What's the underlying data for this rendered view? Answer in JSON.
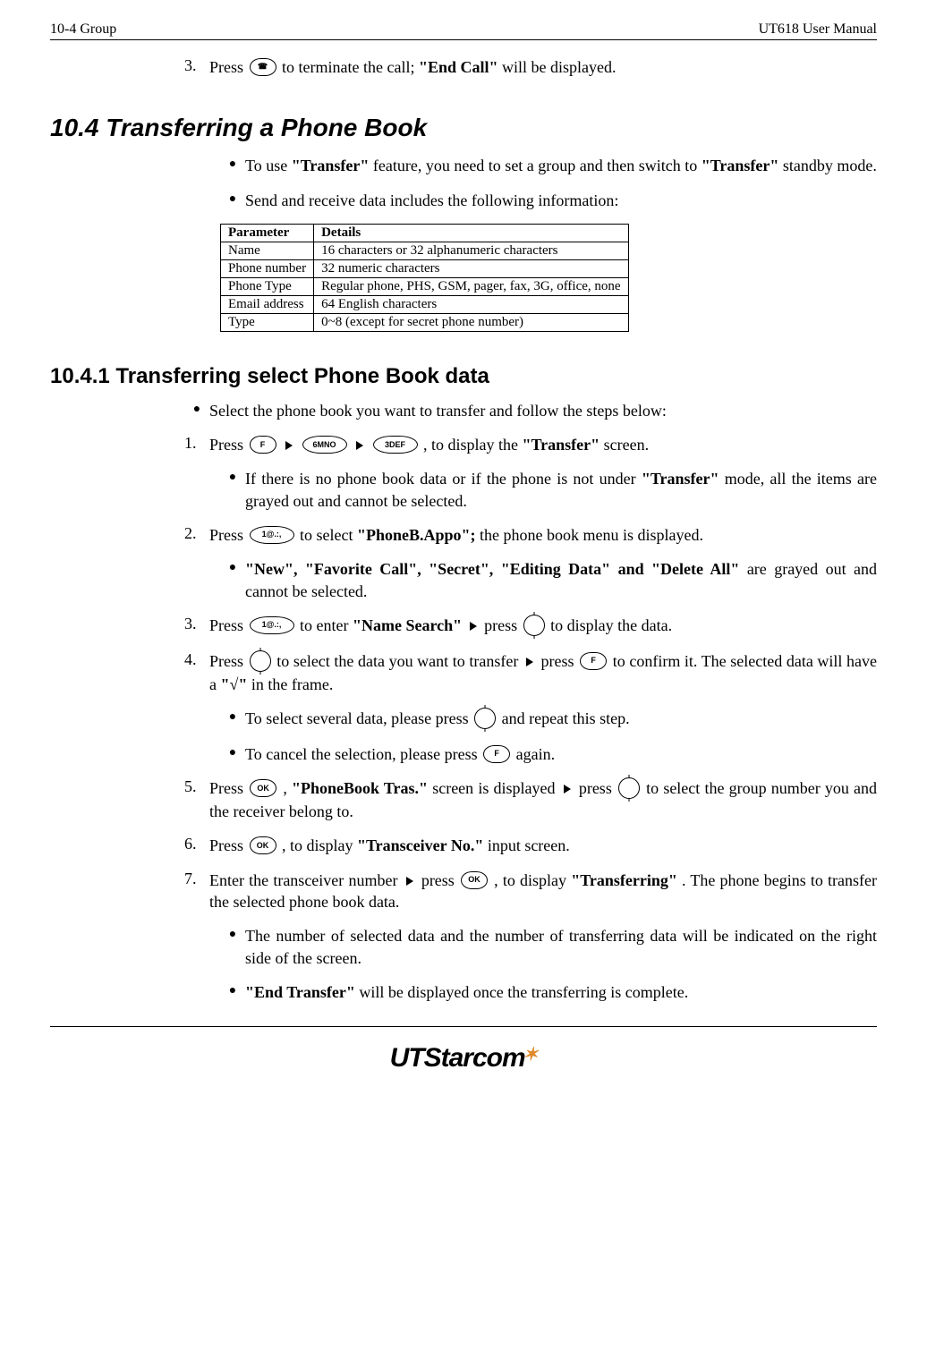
{
  "header": {
    "left": "10-4   Group",
    "right": "UT618 User Manual"
  },
  "step3_top": {
    "num": "3.",
    "pre": "Press ",
    "post": " to terminate the call; ",
    "bold": "\"End Call\"",
    "tail": " will be displayed."
  },
  "ovals": {
    "phone": "☎",
    "F": "F",
    "k6": "6MNO",
    "k3": "3DEF",
    "k1": "1@.:,",
    "OK": "OK"
  },
  "h2": "10.4 Transferring a Phone Book",
  "bul_transfer_use": {
    "text1": "To use ",
    "b1": "\"Transfer\"",
    "text2": " feature, you need to set a group and then switch to ",
    "b2": "\"Transfer\"",
    "text3": " standby mode."
  },
  "bul_send_receive": "Send and receive data includes the following information:",
  "table": {
    "headers": [
      "Parameter",
      "Details"
    ],
    "rows": [
      [
        "Name",
        "16 characters or 32 alphanumeric characters"
      ],
      [
        "Phone number",
        "32 numeric characters"
      ],
      [
        "Phone Type",
        "Regular phone, PHS, GSM, pager, fax, 3G, office, none"
      ],
      [
        "Email address",
        "64 English characters"
      ],
      [
        "Type",
        "0~8 (except for secret phone number)"
      ]
    ]
  },
  "h3": "10.4.1    Transferring select Phone Book data",
  "bul_select_pb": "Select the phone book you want to transfer and follow the steps below:",
  "step1": {
    "num": "1.",
    "pre": "Press ",
    "post": " , to display the ",
    "bold": "\"Transfer\"",
    "tail": " screen."
  },
  "sub1": {
    "text1": "If there is no phone book data or if the phone is not under ",
    "b1": "\"Transfer\"",
    "text2": " mode, all the items are grayed out and cannot be selected."
  },
  "step2": {
    "num": "2.",
    "pre": "Press ",
    "mid": " to select ",
    "bold": "\"PhoneB.Appo\";",
    "tail": " the phone book menu is displayed."
  },
  "sub2": {
    "b1": "\"New\", \"Favorite Call\", \"Secret\", \"Editing Data\" and \"Delete All\"",
    "text": " are grayed out and cannot be selected."
  },
  "step3b": {
    "num": "3.",
    "pre": "Press ",
    "mid1": " to enter ",
    "b1": "\"Name Search\"",
    "mid2": " press ",
    "tail": " to display the data."
  },
  "step4": {
    "num": "4.",
    "pre": "Press ",
    "mid1": " to select the data you want to transfer ",
    "mid2": " press ",
    "mid3": " to confirm it. The selected data will have a ",
    "b1": "\"√\"",
    "tail": " in the frame."
  },
  "sub4a": {
    "text1": "To select several data, please press ",
    "text2": " and repeat this step."
  },
  "sub4b": {
    "text1": "To cancel the selection, please press ",
    "text2": " again."
  },
  "step5": {
    "num": "5.",
    "pre": "Press ",
    "mid1": ", ",
    "b1": "\"PhoneBook Tras.\"",
    "mid2": " screen is displayed ",
    "mid3": " press ",
    "tail": " to select the group number you and the receiver belong to."
  },
  "step6": {
    "num": "6.",
    "pre": "Press ",
    "mid": ", to display ",
    "b1": "\"Transceiver No.\"",
    "tail": " input screen."
  },
  "step7": {
    "num": "7.",
    "pre": "Enter the transceiver number ",
    "mid1": " press ",
    "mid2": ", to display ",
    "b1": "\"Transferring\"",
    "tail": ". The phone begins to transfer the selected phone book data."
  },
  "sub7a": "The number of selected data and the number of transferring data will be indicated on the right side of the screen.",
  "sub7b": {
    "b1": "\"End Transfer\"",
    "text": " will be displayed once the transferring is complete."
  },
  "logo": {
    "ut": "UT",
    "rest": "Starcom",
    "star": "✶"
  }
}
